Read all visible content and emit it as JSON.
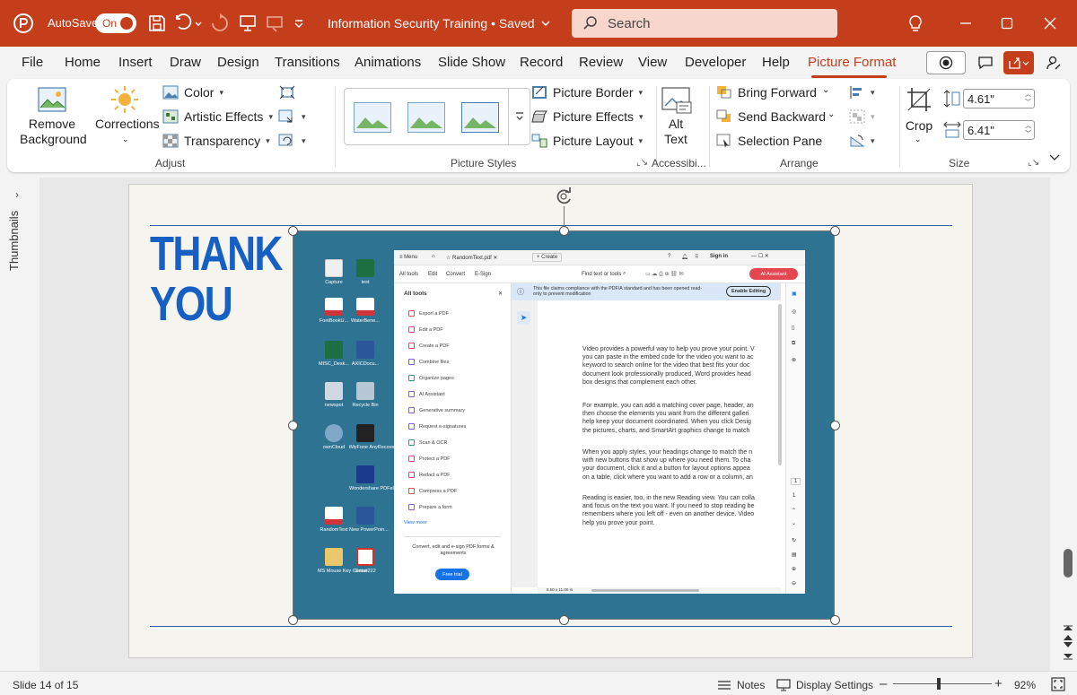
{
  "titlebar": {
    "autosave_label": "AutoSave",
    "autosave_state": "On",
    "doc_title": "Information Security Training • Saved",
    "search_placeholder": "Search",
    "accent": "#c43e1c"
  },
  "menu": {
    "tabs": [
      "File",
      "Home",
      "Insert",
      "Draw",
      "Design",
      "Transitions",
      "Animations",
      "Slide Show",
      "Record",
      "Review",
      "View",
      "Developer",
      "Help",
      "Picture Format"
    ],
    "active": "Picture Format"
  },
  "ribbon": {
    "adjust": {
      "remove_background": "Remove Background",
      "corrections": "Corrections",
      "color": "Color",
      "artistic_effects": "Artistic Effects",
      "transparency": "Transparency",
      "label": "Adjust"
    },
    "picture_styles": {
      "picture_border": "Picture Border",
      "picture_effects": "Picture Effects",
      "picture_layout": "Picture Layout",
      "label": "Picture Styles"
    },
    "accessibility": {
      "alt_text": "Alt Text",
      "label": "Accessibi..."
    },
    "arrange": {
      "bring_forward": "Bring Forward",
      "send_backward": "Send Backward",
      "selection_pane": "Selection Pane",
      "label": "Arrange"
    },
    "size": {
      "crop": "Crop",
      "height": "4.61\"",
      "width": "6.41\"",
      "label": "Size"
    }
  },
  "side": {
    "thumbnails_label": "Thumbnails"
  },
  "slide": {
    "title_line1": "THANK",
    "title_line2": "YOU"
  },
  "desktop_icons": [
    {
      "label": "Capture",
      "color": "#d13438"
    },
    {
      "label": "test",
      "color": "#1d6f42"
    },
    {
      "label": "FontBookU...",
      "color": "#d13438"
    },
    {
      "label": "WaterBene...",
      "color": "#d13438"
    },
    {
      "label": "MISC_Desk...",
      "color": "#1d6f42"
    },
    {
      "label": "AXICDocu...",
      "color": "#2b579a"
    },
    {
      "label": "newspot",
      "color": "#cfd8e3"
    },
    {
      "label": "Recycle Bin",
      "color": "#b8c7d6"
    },
    {
      "label": "ownCloud",
      "color": "#7fa7c7"
    },
    {
      "label": "iMyFone AnyRecover",
      "color": "#222222"
    },
    {
      "label": "Wondershare PDFelement",
      "color": "#1b3a8c"
    },
    {
      "label": "RandomText",
      "color": "#d13438"
    },
    {
      "label": "New PowerPoin...",
      "color": "#2b579a"
    },
    {
      "label": "MS Mouse Key Center",
      "color": "#e8c86a"
    },
    {
      "label": "Gmail222",
      "color": "#d93025"
    }
  ],
  "acrobat": {
    "menu": "Menu",
    "tab_file": "RandomText.pdf",
    "create": "+ Create",
    "sign_in": "Sign in",
    "toolbar_tabs": [
      "All tools",
      "Edit",
      "Convert",
      "E-Sign"
    ],
    "find": "Find text or tools",
    "ai_assistant": "AI Assistant",
    "all_tools": "All tools",
    "tools": [
      "Export a PDF",
      "Edit a PDF",
      "Create a PDF",
      "Combine files",
      "Organize pages",
      "AI Assistant",
      "Generative summary",
      "Request e-signatures",
      "Scan & OCR",
      "Protect a PDF",
      "Redact a PDF",
      "Compress a PDF",
      "Prepare a form"
    ],
    "view_more": "View more",
    "promo": "Convert, edit and e-sign PDF forms & agreements",
    "free_trial": "Free trial",
    "banner": "This file claims compliance with the PDF/A standard and has been opened read-only to prevent modification",
    "enable_editing": "Enable Editing",
    "page_size": "8.50 x 11.00 in",
    "paragraphs": [
      "Video provides a powerful way to help you prove your point. V\nyou can paste in the embed code for the video you want to ac\nkeyword to search online for the video that best fits your doc\ndocument look professionally produced, Word provides head\nbox designs that complement each other.",
      "For example, you can add a matching cover page, header, an\nthen choose the elements you want from the different galleri\nhelp keep your document coordinated. When you click Desig\nthe pictures, charts, and SmartArt graphics change to match",
      "When you apply styles, your headings change to match the n\nwith new buttons that show up where you need them. To cha\nyour document, click it and a button for layout options appea\non a table, click where you want to add a row or a column, an",
      "Reading is easier, too, in the new Reading view. You can colla\nand focus on the text you want. If you need to stop reading be\nremembers where you left off - even on another device. Video\nhelp you prove your point."
    ]
  },
  "status": {
    "slide_counter": "Slide 14 of 15",
    "notes": "Notes",
    "display_settings": "Display Settings",
    "zoom_minus": "–",
    "zoom_plus": "+",
    "zoom": "92%"
  }
}
